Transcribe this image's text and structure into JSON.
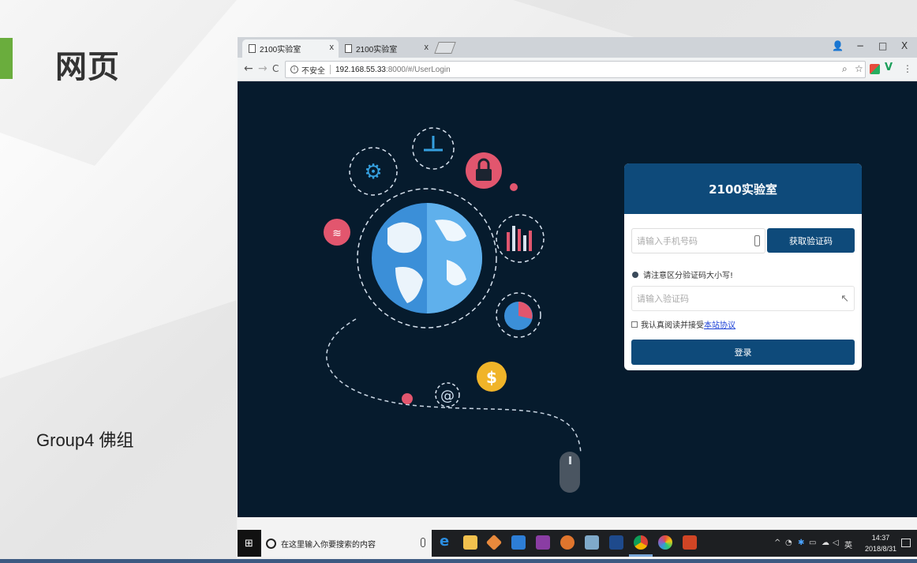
{
  "slide": {
    "title": "网页",
    "subtitle": "Group4 佛组",
    "accent_color": "#6aad3d"
  },
  "browser": {
    "tabs": [
      {
        "label": "2100实验室",
        "active": true
      },
      {
        "label": "2100实验室",
        "active": false
      }
    ],
    "tab_close": "x",
    "window_controls": {
      "minimize": "−",
      "maximize": "□",
      "close": "X"
    },
    "nav": {
      "back": "←",
      "forward": "→",
      "reload": "C"
    },
    "address": {
      "security_label": "不安全",
      "host": "192.168.55.33",
      "path": ":8000/#/UserLogin"
    }
  },
  "login": {
    "title": "2100实验室",
    "phone_placeholder": "请输入手机号码",
    "get_code_button": "获取验证码",
    "notice": "请注意区分验证码大小写!",
    "code_placeholder": "请输入验证码",
    "agree_text": "我认真阅读并接受",
    "agree_link": "本站协议",
    "login_button": "登录",
    "brand_color": "#0e4a7a"
  },
  "taskbar": {
    "search_placeholder": "在这里输入你要搜索的内容",
    "ime_label": "英",
    "time": "14:37",
    "date": "2018/8/31",
    "apps": [
      "edge-icon",
      "file-explorer-icon",
      "git-icon",
      "vscode-icon",
      "onenote-icon",
      "app-orange-icon",
      "notes-icon",
      "powershell-icon",
      "chrome-icon",
      "color-app-icon",
      "powerpoint-icon"
    ]
  }
}
